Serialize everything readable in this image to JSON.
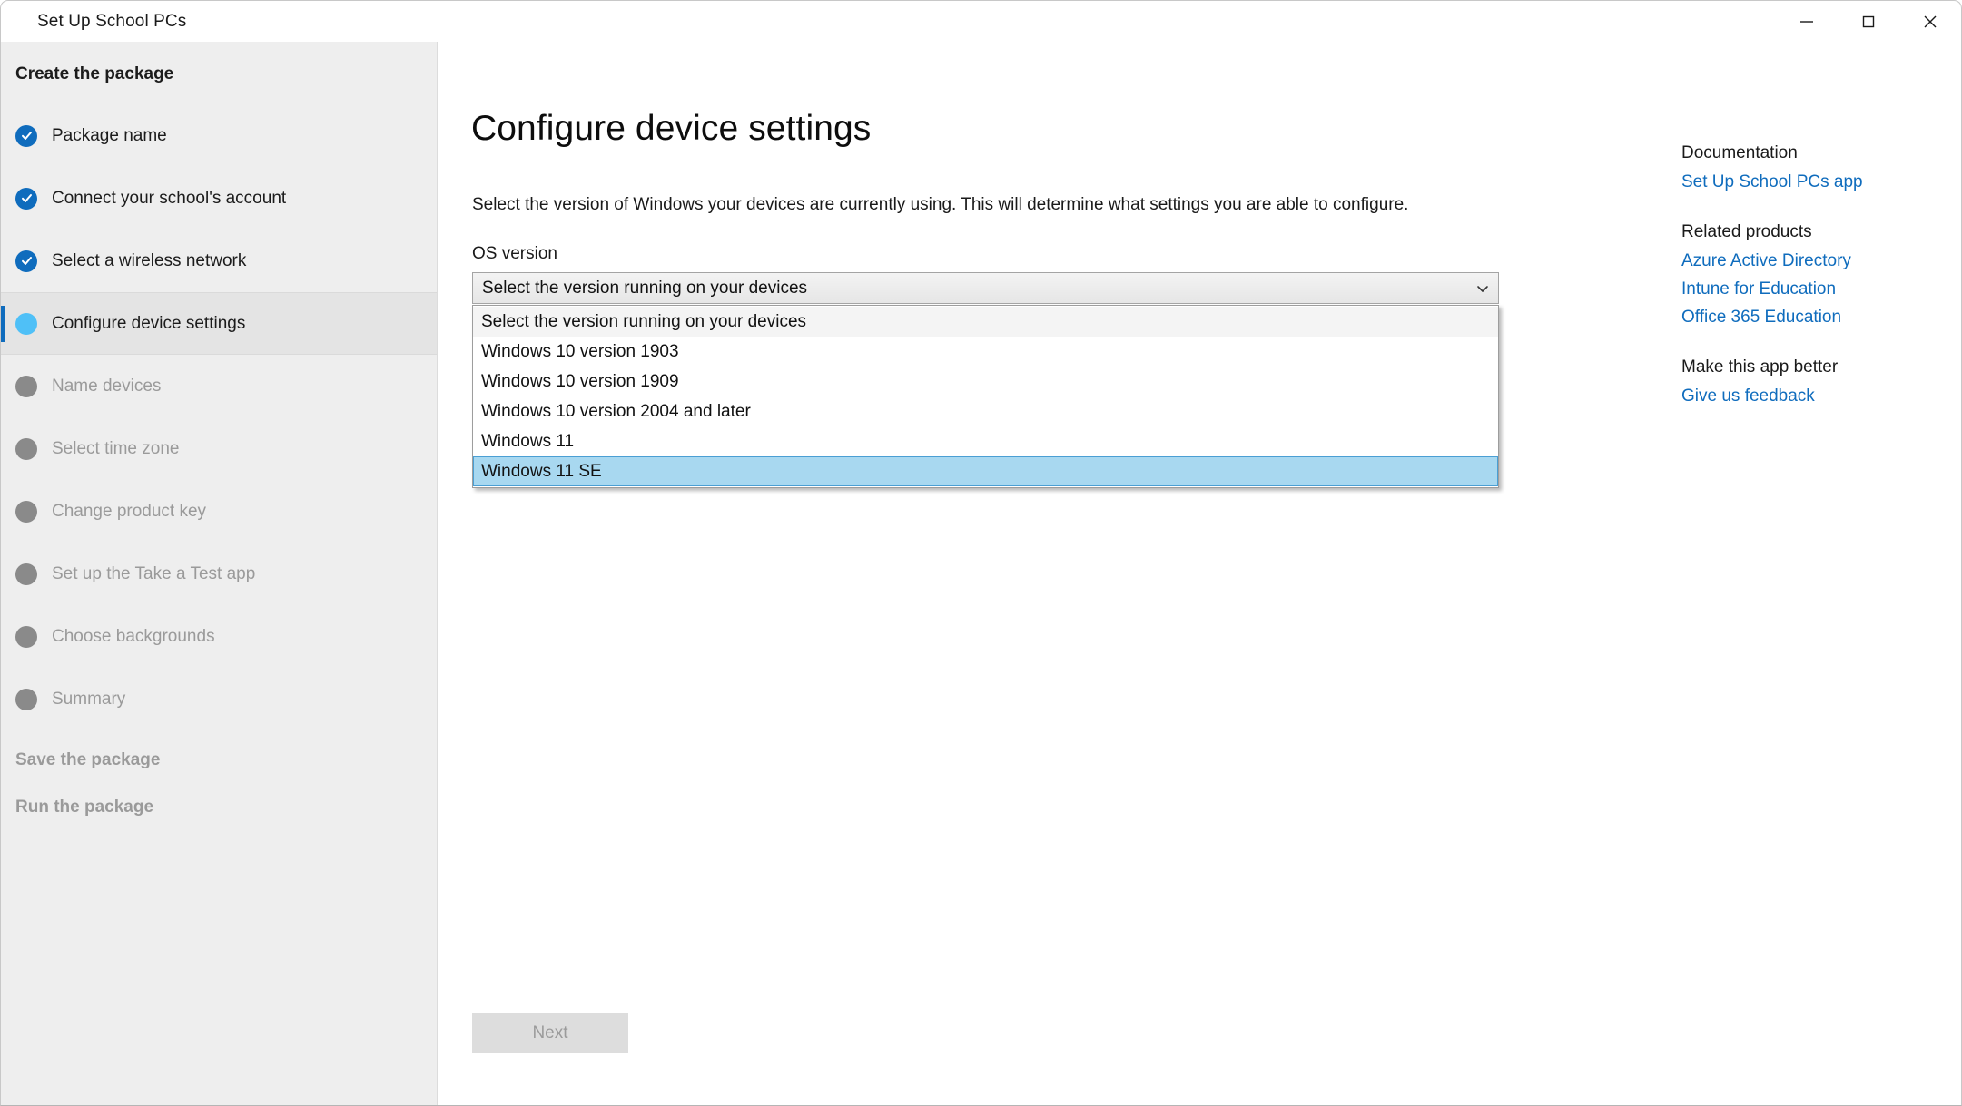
{
  "window": {
    "title": "Set Up School PCs",
    "controls": {
      "minimize": "minimize-icon",
      "maximize": "maximize-icon",
      "close": "close-icon"
    }
  },
  "sidebar": {
    "group_create": "Create the package",
    "group_save": "Save the package",
    "group_run": "Run the package",
    "items": [
      {
        "label": "Package name",
        "state": "done"
      },
      {
        "label": "Connect your school's account",
        "state": "done"
      },
      {
        "label": "Select a wireless network",
        "state": "done"
      },
      {
        "label": "Configure device settings",
        "state": "active"
      },
      {
        "label": "Name devices",
        "state": "pending"
      },
      {
        "label": "Select time zone",
        "state": "pending"
      },
      {
        "label": "Change product key",
        "state": "pending"
      },
      {
        "label": "Set up the Take a Test app",
        "state": "pending"
      },
      {
        "label": "Choose backgrounds",
        "state": "pending"
      },
      {
        "label": "Summary",
        "state": "pending"
      }
    ]
  },
  "main": {
    "title": "Configure device settings",
    "description": "Select the version of Windows your devices are currently using. This will determine what settings you are able to configure.",
    "field_label": "OS version",
    "combo": {
      "value": "Select the version running on your devices",
      "expanded": true,
      "selected_index": 5,
      "options": [
        "Select the version running on your devices",
        "Windows 10 version 1903",
        "Windows 10 version 1909",
        "Windows 10 version 2004 and later",
        "Windows 11",
        "Windows 11 SE"
      ]
    },
    "next_label": "Next"
  },
  "help": {
    "documentation_heading": "Documentation",
    "documentation_links": [
      "Set Up School PCs app"
    ],
    "related_heading": "Related products",
    "related_links": [
      "Azure Active Directory",
      "Intune for Education",
      "Office 365 Education"
    ],
    "feedback_heading": "Make this app better",
    "feedback_links": [
      "Give us feedback"
    ]
  },
  "colors": {
    "accent": "#0f6cbd",
    "active_bullet": "#4fc0f7",
    "pending_bullet": "#8a8a8a",
    "selection": "#a8d8f0"
  }
}
